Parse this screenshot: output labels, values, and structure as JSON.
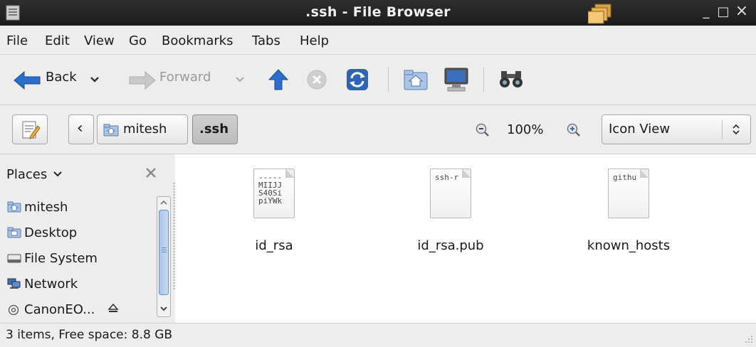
{
  "window": {
    "title": ".ssh - File Browser",
    "minimize": "_",
    "maximize": "□",
    "close": "×"
  },
  "menubar": {
    "items": [
      "File",
      "Edit",
      "View",
      "Go",
      "Bookmarks",
      "Tabs",
      "Help"
    ]
  },
  "toolbar": {
    "back_label": "Back",
    "forward_label": "Forward"
  },
  "location": {
    "path": [
      "mitesh",
      ".ssh"
    ],
    "back_chevron": "‹",
    "zoom": "100%",
    "view_mode": "Icon View"
  },
  "sidebar": {
    "header": "Places",
    "items": [
      {
        "label": "mitesh",
        "icon": "home-folder-icon"
      },
      {
        "label": "Desktop",
        "icon": "desktop-folder-icon"
      },
      {
        "label": "File System",
        "icon": "drive-icon"
      },
      {
        "label": "Network",
        "icon": "network-icon"
      },
      {
        "label": "CanonEO...",
        "icon": "camera-icon"
      }
    ]
  },
  "files": [
    {
      "name": "id_rsa",
      "preview": [
        "-----",
        "MIIJJ",
        "S40Si",
        "piYWk"
      ]
    },
    {
      "name": "id_rsa.pub",
      "preview": [
        "ssh-r"
      ]
    },
    {
      "name": "known_hosts",
      "preview": [
        "githu"
      ]
    }
  ],
  "status": {
    "text": "3 items, Free space: 8.8 GB"
  },
  "colors": {
    "accent_blue": "#2a6fc9",
    "titlebar": "#222222",
    "folder_orange": "#f0b030"
  }
}
